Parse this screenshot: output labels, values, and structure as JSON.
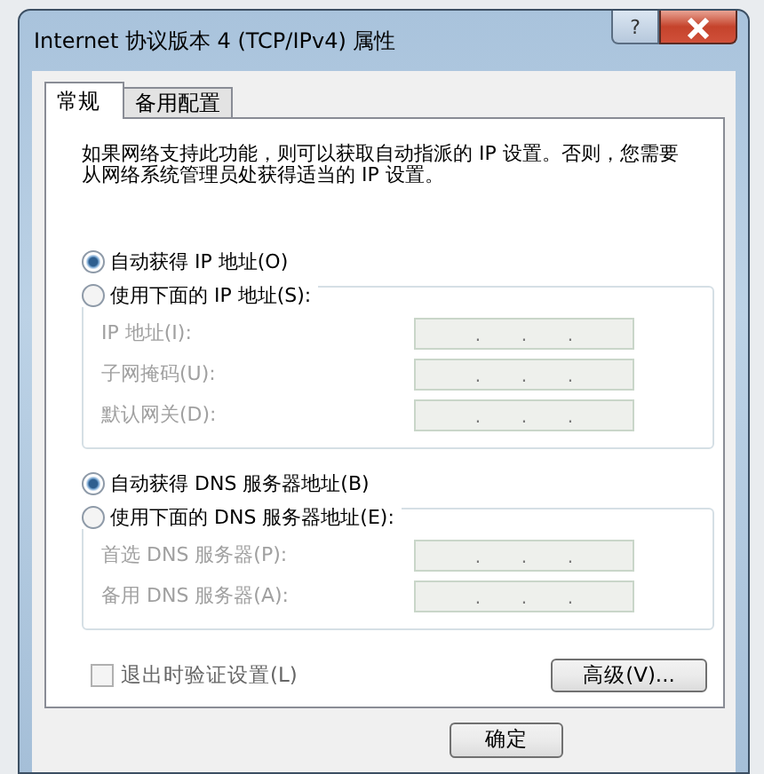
{
  "window": {
    "title": "Internet 协议版本 4 (TCP/IPv4) 属性",
    "help_button": "?"
  },
  "tabs": [
    {
      "label": "常规",
      "selected": true
    },
    {
      "label": "备用配置",
      "selected": false
    }
  ],
  "description": "如果网络支持此功能，则可以获取自动指派的 IP 设置。否则，您需要从网络系统管理员处获得适当的 IP 设置。",
  "sections": [
    {
      "radios": [
        {
          "label": "自动获得 IP 地址(O)",
          "selected": true
        },
        {
          "label": "使用下面的 IP 地址(S):",
          "selected": false
        }
      ],
      "fields": [
        {
          "label": "IP 地址(I):",
          "disabled": true,
          "separators": [
            ".",
            ".",
            "."
          ]
        },
        {
          "label": "子网掩码(U):",
          "disabled": true,
          "separators": [
            ".",
            ".",
            "."
          ]
        },
        {
          "label": "默认网关(D):",
          "disabled": true,
          "separators": [
            ".",
            ".",
            "."
          ]
        }
      ]
    },
    {
      "radios": [
        {
          "label": "自动获得 DNS 服务器地址(B)",
          "selected": true
        },
        {
          "label": "使用下面的 DNS 服务器地址(E):",
          "selected": false
        }
      ],
      "fields": [
        {
          "label": "首选 DNS 服务器(P):",
          "disabled": true,
          "separators": [
            ".",
            ".",
            "."
          ]
        },
        {
          "label": "备用 DNS 服务器(A):",
          "disabled": true,
          "separators": [
            ".",
            ".",
            "."
          ]
        }
      ]
    }
  ],
  "validate_checkbox": {
    "label": "退出时验证设置(L)",
    "checked": false,
    "disabled": true
  },
  "advanced_button": "高级(V)...",
  "ok_button": "确定"
}
